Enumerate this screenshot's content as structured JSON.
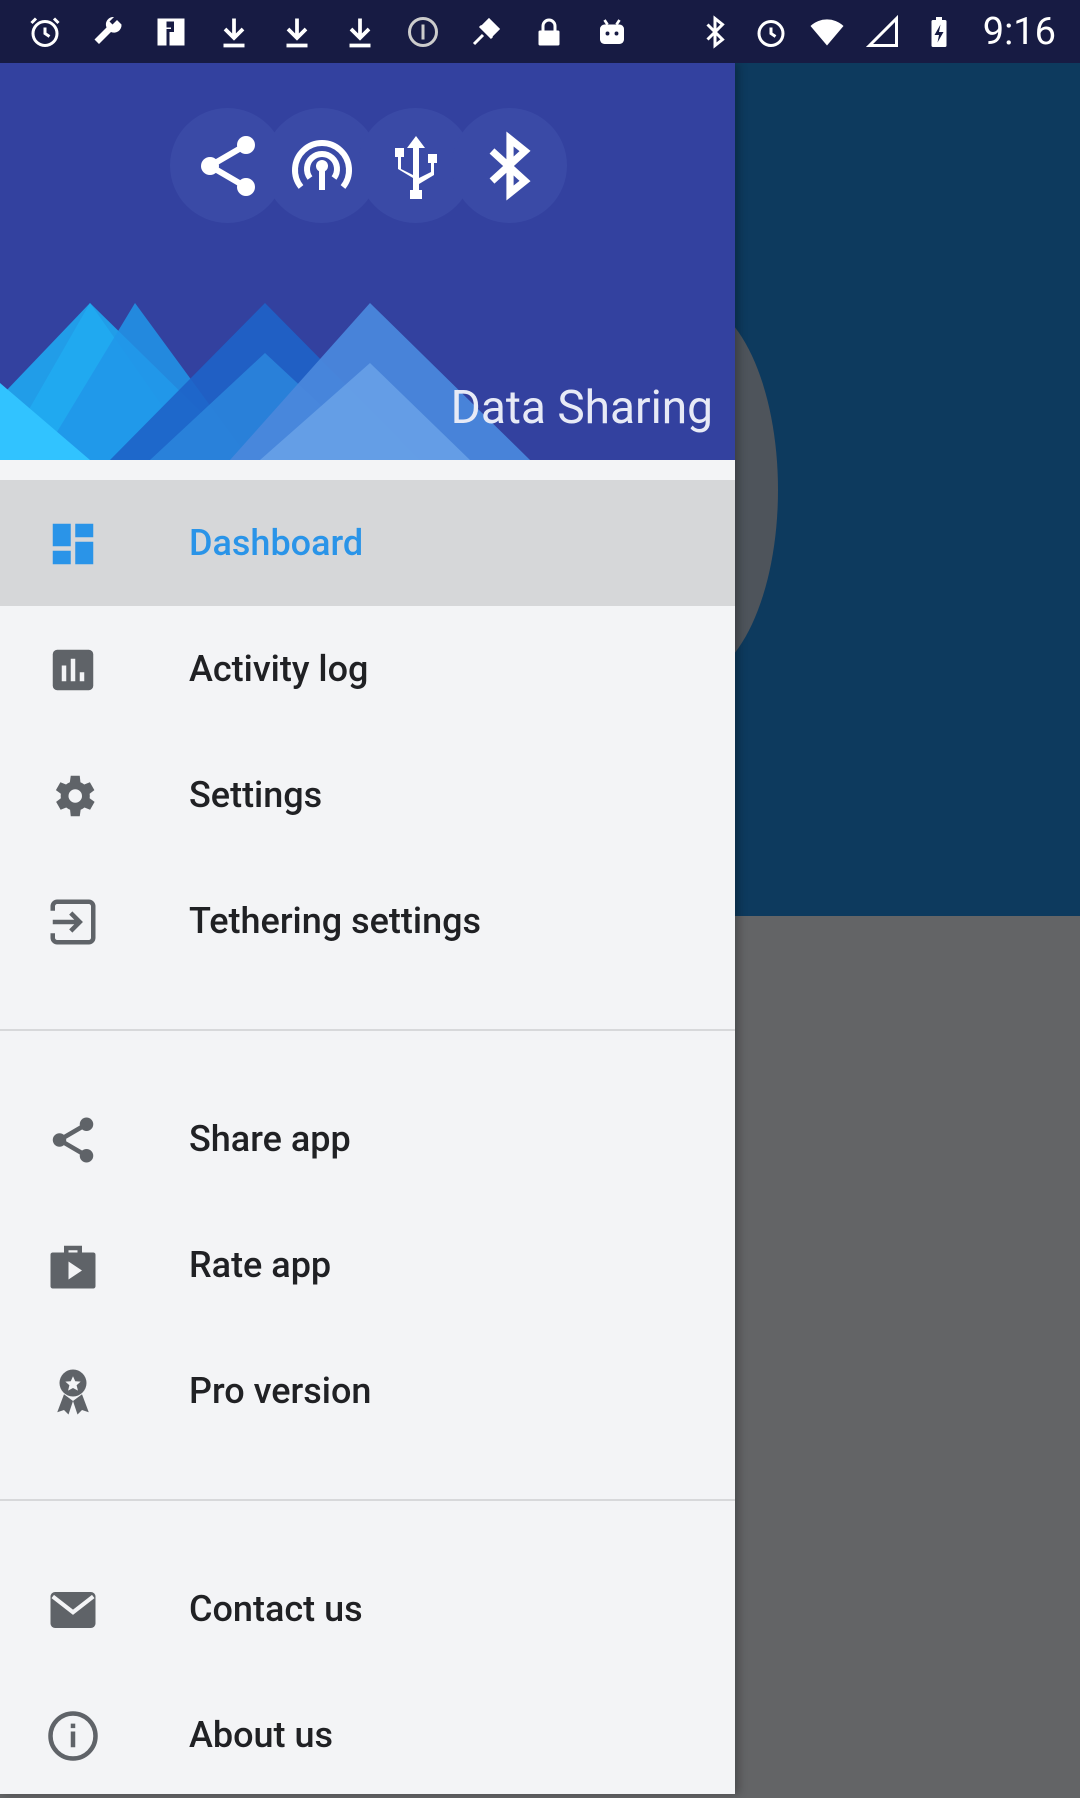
{
  "status_bar": {
    "time": "9:16",
    "left_icons": [
      "alarm-icon",
      "wrench-icon",
      "app-f-icon",
      "download-icon",
      "download-icon",
      "download-icon",
      "info-circle-icon",
      "fake-gps-icon",
      "lock-icon",
      "android-icon"
    ],
    "right_icons": [
      "bluetooth-icon",
      "alarm-icon",
      "wifi-icon",
      "signal-off-icon",
      "battery-charging-icon"
    ]
  },
  "drawer": {
    "header": {
      "title": "Data Sharing",
      "icons": [
        "share-icon",
        "hotspot-icon",
        "usb-icon",
        "bluetooth-icon"
      ],
      "bg_color": "#33419f"
    },
    "menu_groups": [
      [
        {
          "id": "dashboard",
          "label": "Dashboard",
          "icon": "dashboard-icon",
          "active": true
        },
        {
          "id": "activity-log",
          "label": "Activity log",
          "icon": "bar-chart-icon"
        },
        {
          "id": "settings",
          "label": "Settings",
          "icon": "gear-icon"
        },
        {
          "id": "tethering-settings",
          "label": "Tethering settings",
          "icon": "exit-to-app-icon"
        }
      ],
      [
        {
          "id": "share-app",
          "label": "Share app",
          "icon": "share-icon"
        },
        {
          "id": "rate-app",
          "label": "Rate app",
          "icon": "play-store-icon"
        },
        {
          "id": "pro-version",
          "label": "Pro version",
          "icon": "award-icon"
        }
      ],
      [
        {
          "id": "contact-us",
          "label": "Contact us",
          "icon": "mail-icon"
        },
        {
          "id": "about-us",
          "label": "About us",
          "icon": "info-icon"
        }
      ]
    ],
    "accent_color": "#2a94e8"
  }
}
